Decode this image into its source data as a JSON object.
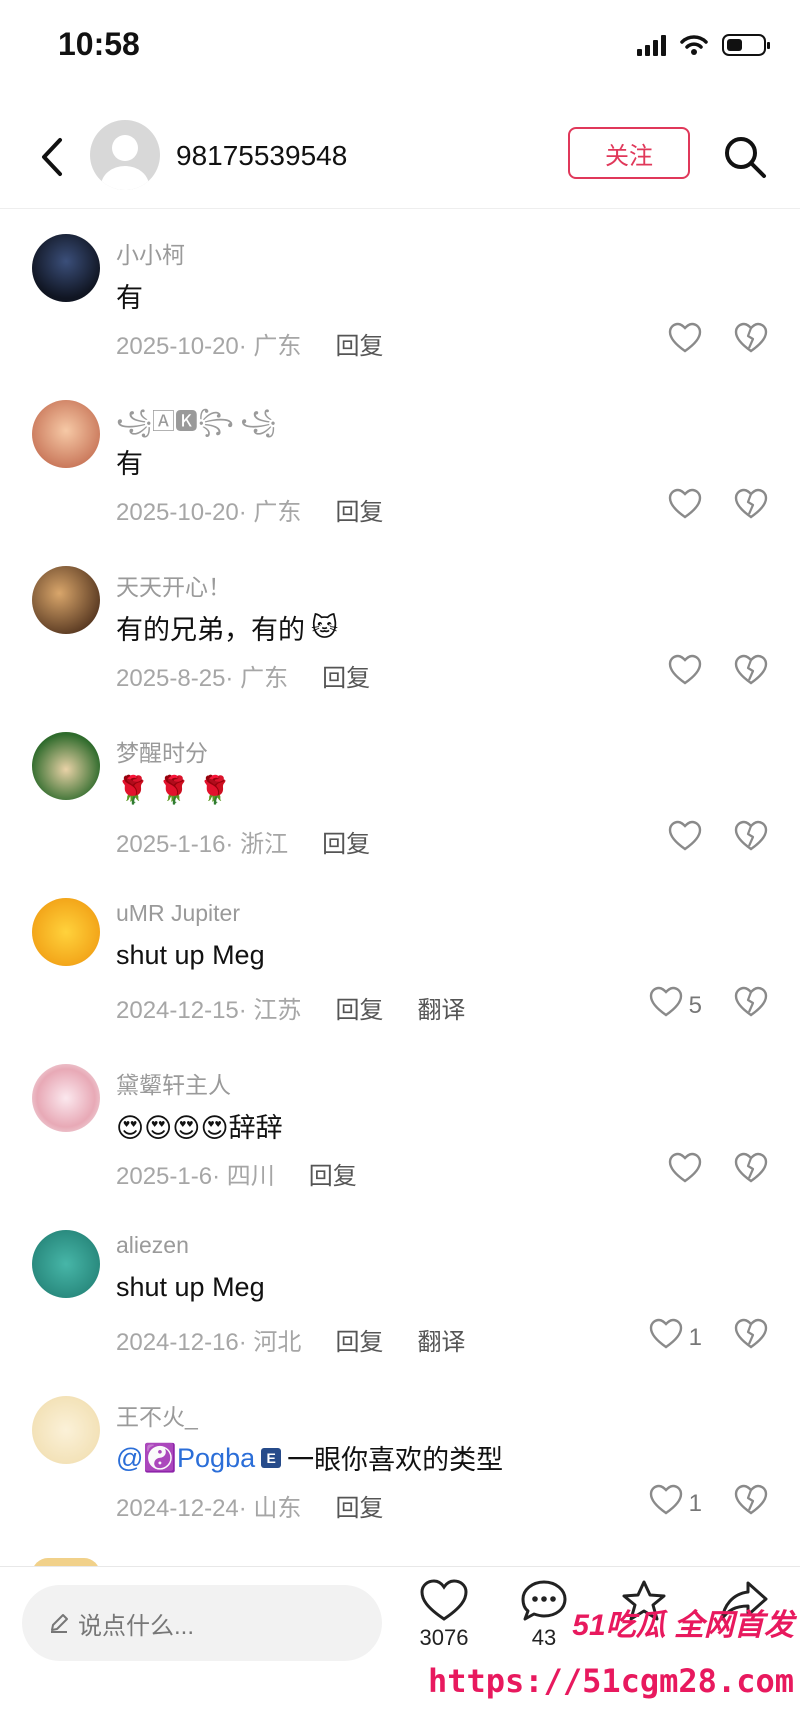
{
  "status_bar": {
    "time": "10:58",
    "battery_level": 0.45
  },
  "header": {
    "title": "98175539548",
    "follow_label": "关注"
  },
  "comments": [
    {
      "name": "小小柯",
      "text": "有",
      "date": "2025-10-20",
      "region": "广东",
      "reply": "回复"
    },
    {
      "name": "꧁🄰🅺꧂ ꧁",
      "text": "有",
      "date": "2025-10-20",
      "region": "广东",
      "reply": "回复"
    },
    {
      "name": "天天开心！",
      "text": "有的兄弟，有的",
      "emoji": "🐱",
      "date": "2025-8-25",
      "region": "广东",
      "reply": "回复"
    },
    {
      "name": "梦醒时分",
      "text": "🌹 🌹 🌹",
      "date": "2025-1-16",
      "region": "浙江",
      "reply": "回复"
    },
    {
      "name": "uMR Jupiter",
      "text": "shut up Meg",
      "date": "2024-12-15",
      "region": "江苏",
      "reply": "回复",
      "translate": "翻译",
      "likes": "5"
    },
    {
      "name": "黛颦轩主人",
      "text": "😍😍😍😍辞辞",
      "date": "2025-1-6",
      "region": "四川",
      "reply": "回复"
    },
    {
      "name": "aliezen",
      "text": "shut up Meg",
      "date": "2024-12-16",
      "region": "河北",
      "reply": "回复",
      "translate": "翻译",
      "likes": "1"
    },
    {
      "name": "王不火_",
      "mention": "@☯️Pogba",
      "badge": "E",
      "text": "一眼你喜欢的类型",
      "date": "2024-12-24",
      "region": "山东",
      "reply": "回复",
      "likes": "1"
    }
  ],
  "bottom_bar": {
    "input_placeholder": "说点什么...",
    "like_count": "3076",
    "comment_count": "43",
    "star_count": "",
    "share_count": ""
  },
  "watermark": {
    "brand": "51吃瓜 全网首发",
    "url": "https://51cgm28.com"
  },
  "colors": {
    "accent": "#e0385a",
    "mention": "#2b6ed8",
    "watermark": "#e8195e"
  },
  "icons": [
    "back-icon",
    "search-icon",
    "heart-icon",
    "broken-heart-icon",
    "pencil-icon",
    "comment-icon",
    "star-icon",
    "share-icon"
  ]
}
